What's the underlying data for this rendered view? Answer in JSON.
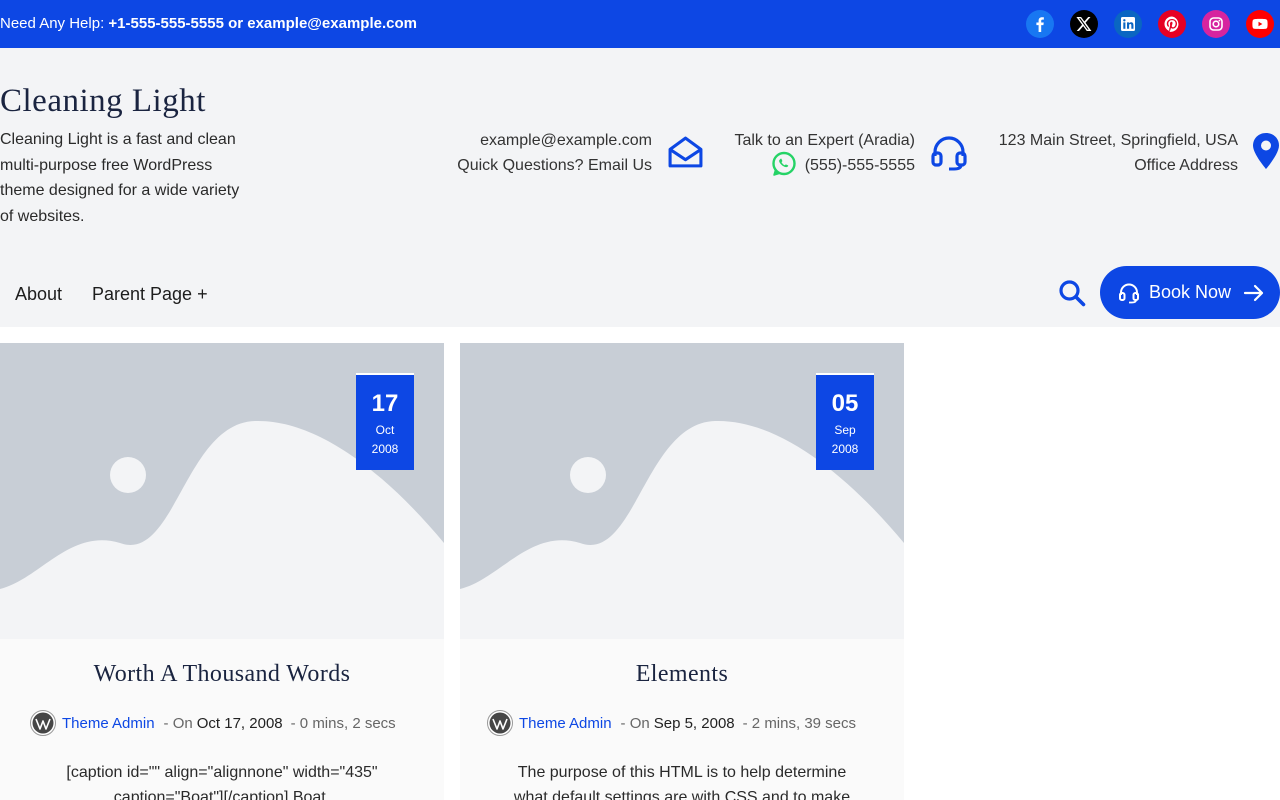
{
  "topbar": {
    "help_label": "Need Any Help:",
    "help_contact": "+1-555-555-5555 or example@example.com",
    "socials": [
      {
        "icon": "facebook-icon",
        "color": "#1877f2"
      },
      {
        "icon": "x-icon",
        "color": "#000000"
      },
      {
        "icon": "linkedin-icon",
        "color": "#0a66c2"
      },
      {
        "icon": "pinterest-icon",
        "color": "#e60023"
      },
      {
        "icon": "instagram-icon",
        "color": "#d6249f"
      },
      {
        "icon": "youtube-icon",
        "color": "#ff0000"
      }
    ]
  },
  "header": {
    "site_title": "Cleaning Light",
    "site_description": "Cleaning Light is a fast and clean multi-purpose free WordPress theme designed for a wide variety of websites.",
    "email": {
      "line1": "example@example.com",
      "line2": "Quick Questions? Email Us"
    },
    "expert": {
      "line1": "Talk to an Expert (Aradia)",
      "line2": "(555)-555-5555"
    },
    "address": {
      "line1": "123 Main Street, Springfield, USA",
      "line2": "Office Address"
    }
  },
  "nav": {
    "items": [
      "About",
      "Parent Page +"
    ],
    "book_label": "Book Now"
  },
  "posts": [
    {
      "day": "17",
      "month": "Oct",
      "year": "2008",
      "title": "Worth A Thousand Words",
      "author": "Theme Admin",
      "on_label": "- On",
      "date": "Oct 17, 2008",
      "read_time": "- 0 mins, 2 secs",
      "excerpt": "[caption id=\"\" align=\"alignnone\" width=\"435\" caption=\"Boat\"][/caption] Boat."
    },
    {
      "day": "05",
      "month": "Sep",
      "year": "2008",
      "title": "Elements",
      "author": "Theme Admin",
      "on_label": "- On",
      "date": "Sep 5, 2008",
      "read_time": "- 2 mins, 39 secs",
      "excerpt": "The purpose of this HTML is to help determine what default settings are with CSS and to make sure that…"
    }
  ],
  "colors": {
    "accent": "#0d47e4",
    "header_bg": "#f3f4f6",
    "whatsapp": "#25d366"
  }
}
